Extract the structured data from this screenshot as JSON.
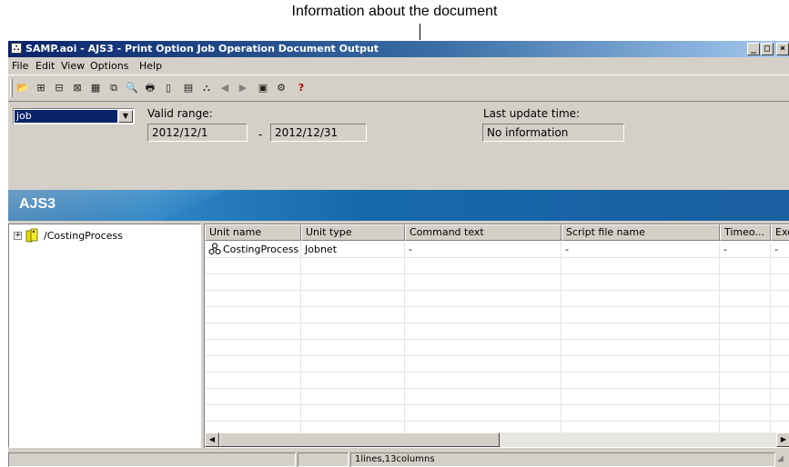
{
  "annotation": {
    "text": "Information about the document"
  },
  "window": {
    "title": "SAMP.aoi - AJS3 - Print Option Job Operation Document Output",
    "controls": {
      "minimize": "_",
      "maximize": "□",
      "close": "×"
    }
  },
  "menu": {
    "items": [
      "File",
      "Edit",
      "View",
      "Options",
      "Help"
    ]
  },
  "toolbar": {
    "icons": [
      "open-icon",
      "job-view-icon",
      "jobnet-view-icon",
      "structure-view-icon",
      "schedule-view-icon",
      "export-icon",
      "print-preview-icon",
      "print-icon",
      "page-icon",
      "definition-icon",
      "network-icon",
      "previous-icon",
      "next-icon",
      "details-icon",
      "settings-icon",
      "help-icon"
    ]
  },
  "options": {
    "unit_type_selected": "job",
    "valid_range_label": "Valid range:",
    "range_from": "2012/12/1",
    "range_separator": "-",
    "range_to": "2012/12/31",
    "last_update_label": "Last update time:",
    "last_update_value": "No information"
  },
  "banner": {
    "text": "AJS3"
  },
  "tree": {
    "expander": "+",
    "root_label": "/CostingProcess"
  },
  "list": {
    "columns": [
      "Unit name",
      "Unit type",
      "Command text",
      "Script file name",
      "Timeo...",
      "Exe"
    ],
    "rows": [
      {
        "unit_name": "CostingProcess",
        "unit_type": "Jobnet",
        "command_text": "-",
        "script_file_name": "-",
        "timeout": "-",
        "exe": "-"
      }
    ]
  },
  "status": {
    "lines_columns": "1lines,13columns"
  },
  "colors": {
    "title_active": "#0a246a",
    "banner": "#1a6aaa",
    "selection": "#0a246a"
  }
}
